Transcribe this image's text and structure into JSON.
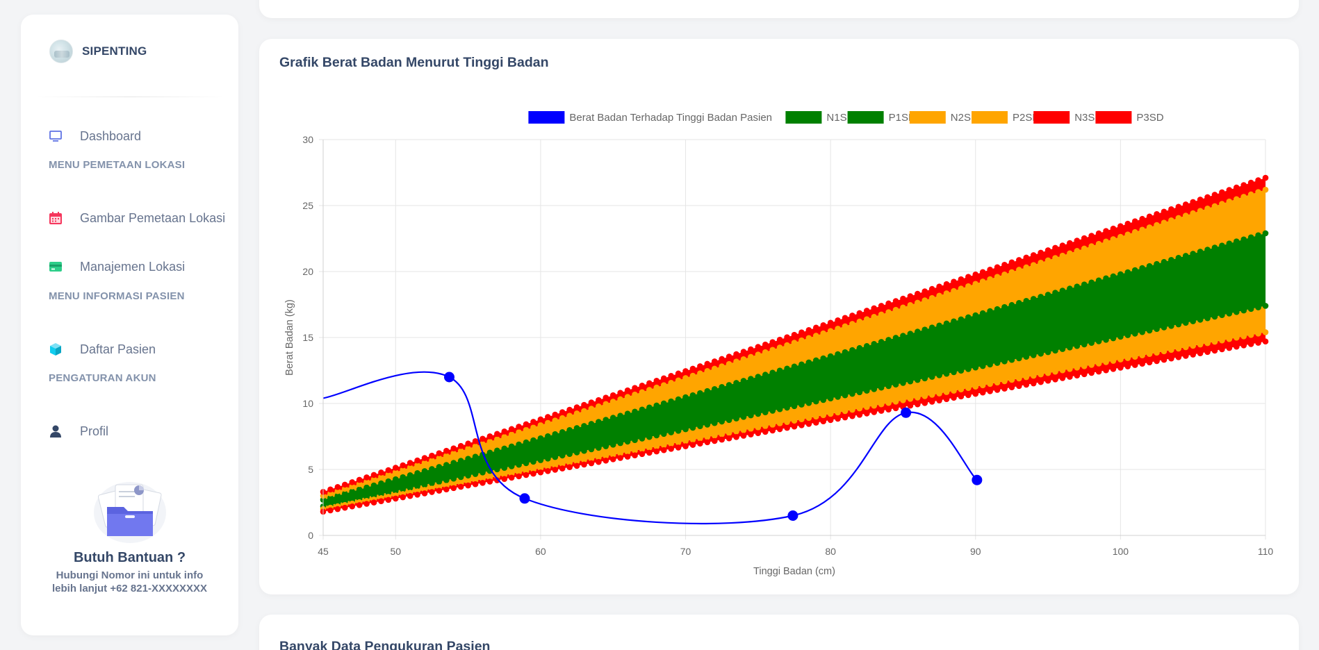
{
  "brand": {
    "name": "SIPENTING"
  },
  "sidebar": {
    "items": [
      {
        "label": "Dashboard",
        "icon": "monitor-icon",
        "color": "#5e72e4"
      },
      {
        "section": "MENU PEMETAAN LOKASI"
      },
      {
        "label": "Gambar Pemetaan Lokasi",
        "icon": "calendar-icon",
        "color": "#f5365c"
      },
      {
        "label": "Manajemen Lokasi",
        "icon": "credit-card-icon",
        "color": "#2dce89"
      },
      {
        "section": "MENU INFORMASI PASIEN"
      },
      {
        "label": "Daftar Pasien",
        "icon": "box-icon",
        "color": "#11cdef"
      },
      {
        "section": "PENGATURAN AKUN"
      },
      {
        "label": "Profil",
        "icon": "user-icon",
        "color": "#344767"
      }
    ],
    "help": {
      "title": "Butuh Bantuan ?",
      "text_line1": "Hubungi Nomor ini untuk info",
      "text_line2": "lebih lanjut +62 821-XXXXXXXX"
    }
  },
  "main": {
    "chart_card_title": "Grafik Berat Badan Menurut Tinggi Badan",
    "next_card_title": "Banyak Data Pengukuran Pasien"
  },
  "chart_data": {
    "type": "line",
    "xlabel": "Tinggi Badan (cm)",
    "ylabel": "Berat Badan (kg)",
    "xlim": [
      45,
      110
    ],
    "ylim": [
      0,
      30
    ],
    "xticks": [
      45,
      50,
      60,
      70,
      80,
      90,
      100,
      110
    ],
    "yticks": [
      0,
      5,
      10,
      15,
      20,
      25,
      30
    ],
    "grid": true,
    "legend_position": "top",
    "patient_series": {
      "name": "Berat Badan Terhadap Tinggi Badan Pasien",
      "color": "#0000ff",
      "x": [
        45,
        53.7,
        58.9,
        77.4,
        85.2,
        90.1
      ],
      "y": [
        10.4,
        12.0,
        2.8,
        1.5,
        9.3,
        4.2
      ]
    },
    "reference_band": {
      "x_start": 45,
      "x_end": 110,
      "x_step": 0.5
    },
    "reference_series": [
      {
        "name": "N1SD",
        "color": "#008000",
        "y_start": 2.2,
        "y_end": 17.4
      },
      {
        "name": "P1SD",
        "color": "#008000",
        "y_start": 2.7,
        "y_end": 22.9
      },
      {
        "name": "N2SD",
        "color": "#ffa500",
        "y_start": 2.0,
        "y_end": 15.4
      },
      {
        "name": "P2SD",
        "color": "#ffa500",
        "y_start": 3.0,
        "y_end": 26.2
      },
      {
        "name": "N3SD",
        "color": "#ff0000",
        "y_start": 1.8,
        "y_end": 14.7
      },
      {
        "name": "P3SD",
        "color": "#ff0000",
        "y_start": 3.3,
        "y_end": 27.1
      }
    ]
  }
}
